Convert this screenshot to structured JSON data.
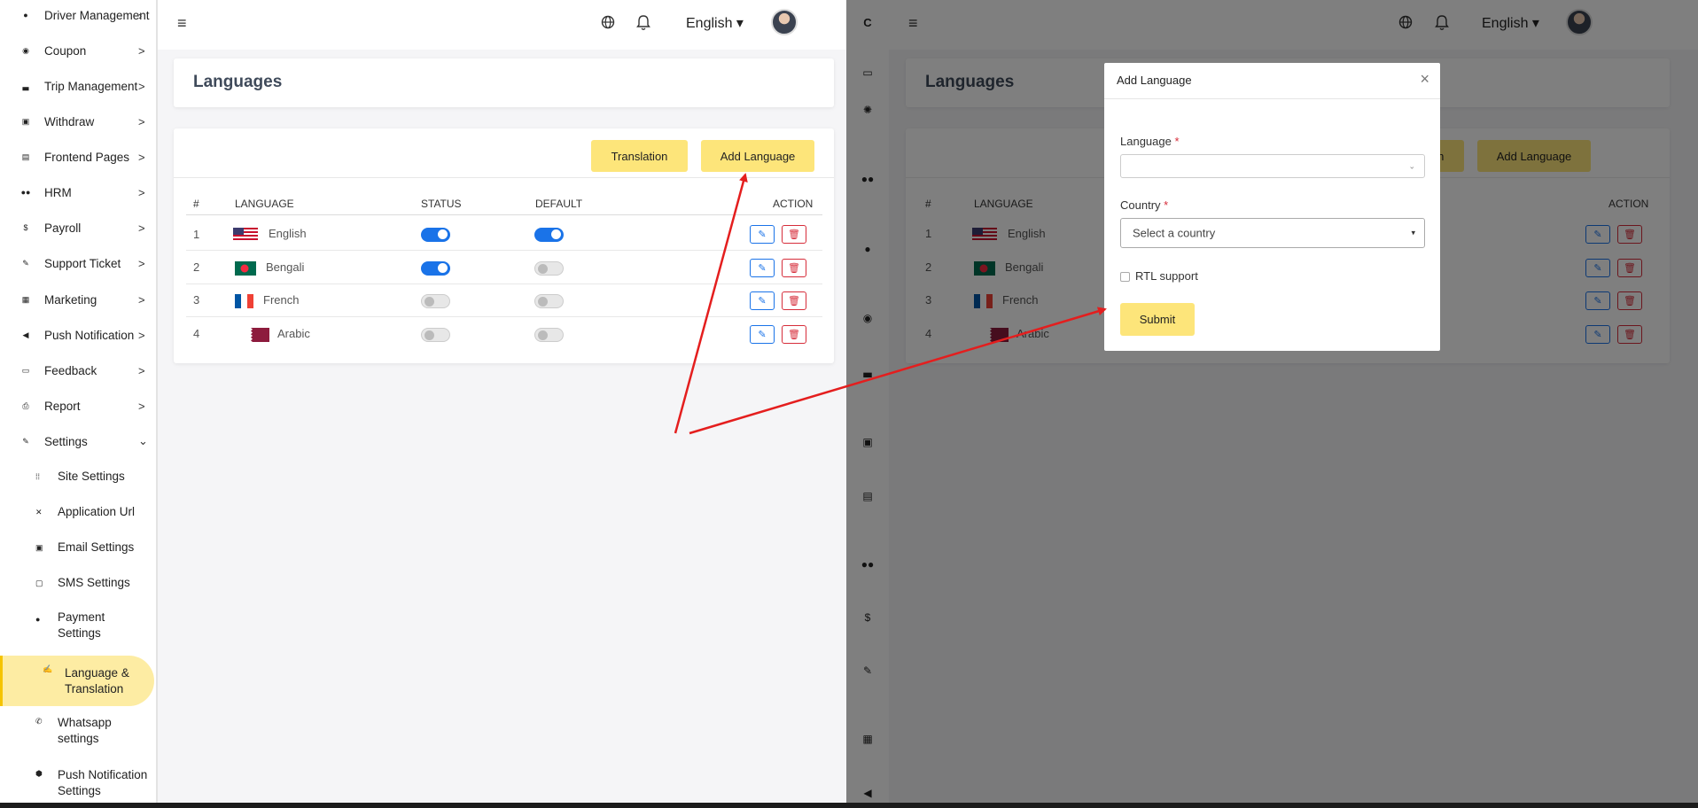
{
  "sidebar": {
    "items": [
      {
        "label": "Driver Management",
        "icon": "user-icon",
        "chevron": "›"
      },
      {
        "label": "Coupon",
        "icon": "coupon-icon",
        "chevron": ">"
      },
      {
        "label": "Trip Management",
        "icon": "car-icon",
        "chevron": ">"
      },
      {
        "label": "Withdraw",
        "icon": "withdraw-icon",
        "chevron": ">"
      },
      {
        "label": "Frontend Pages",
        "icon": "pages-icon",
        "chevron": ">"
      },
      {
        "label": "HRM",
        "icon": "hrm-icon",
        "chevron": ">"
      },
      {
        "label": "Payroll",
        "icon": "dollar-icon",
        "chevron": ">"
      },
      {
        "label": "Support Ticket",
        "icon": "wrench-icon",
        "chevron": ">"
      },
      {
        "label": "Marketing",
        "icon": "grid-icon",
        "chevron": ">"
      },
      {
        "label": "Push Notification",
        "icon": "megaphone-icon",
        "chevron": ">"
      },
      {
        "label": "Feedback",
        "icon": "feedback-icon",
        "chevron": ">"
      },
      {
        "label": "Report",
        "icon": "print-icon",
        "chevron": ">"
      },
      {
        "label": "Settings",
        "icon": "wrench-icon",
        "chevron": "⌄"
      }
    ],
    "sub_items": [
      {
        "label": "Site Settings",
        "icon": "sliders-icon"
      },
      {
        "label": "Application Url",
        "icon": "tools-icon"
      },
      {
        "label": "Email Settings",
        "icon": "email-icon"
      },
      {
        "label": "SMS Settings",
        "icon": "sms-icon"
      },
      {
        "label_line1": "Payment",
        "label_line2": "Settings",
        "icon": "payment-icon"
      },
      {
        "label_line1": "Language &",
        "label_line2": "Translation",
        "icon": "language-icon"
      },
      {
        "label_line1": "Whatsapp",
        "label_line2": "settings",
        "icon": "phone-icon"
      },
      {
        "label_line1": "Push Notification",
        "label_line2": "Settings",
        "icon": "bell-icon"
      }
    ]
  },
  "topbar": {
    "hamburger": "≡",
    "language": "English ▾",
    "right_logo": "C"
  },
  "page": {
    "title": "Languages",
    "translation_button": "Translation",
    "add_language_button": "Add Language"
  },
  "table": {
    "headers": [
      "#",
      "LANGUAGE",
      "STATUS",
      "DEFAULT",
      "ACTION"
    ],
    "rows": [
      {
        "num": "1",
        "language": "English",
        "flag": "us",
        "status": true,
        "default": true
      },
      {
        "num": "2",
        "language": "Bengali",
        "flag": "bd",
        "status": true,
        "default": false
      },
      {
        "num": "3",
        "language": "French",
        "flag": "fr",
        "status": false,
        "default": false
      },
      {
        "num": "4",
        "language": "Arabic",
        "flag": "qa",
        "status": false,
        "default": false
      }
    ]
  },
  "modal": {
    "title": "Add Language",
    "close": "×",
    "language_label": "Language",
    "language_value": "",
    "country_label": "Country",
    "country_placeholder": "Select a country",
    "required_mark": "*",
    "rtl_label": "RTL support",
    "submit": "Submit"
  },
  "colors": {
    "accent_yellow": "#fde57a",
    "toggle_on": "#1a73e8",
    "danger": "#d62d3a",
    "annotation_arrow": "#e41e1e"
  }
}
